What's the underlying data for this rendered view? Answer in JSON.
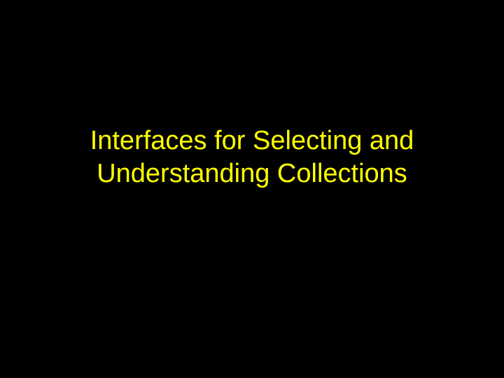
{
  "slide": {
    "title": "Interfaces for Selecting and Understanding Collections",
    "background": "#000000",
    "text_color": "#FFFF00"
  }
}
